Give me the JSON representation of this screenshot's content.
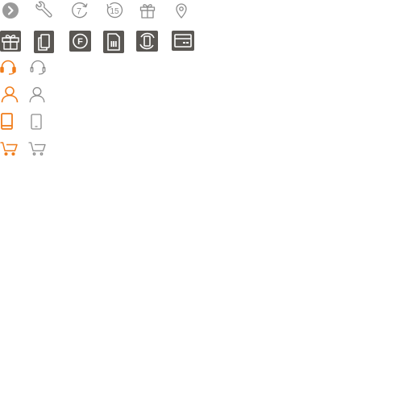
{
  "colors": {
    "gray": "#8c8c8c",
    "dark_tile": "#5a5753",
    "tile_glyph": "#ffffff",
    "orange": "#f07d1b",
    "chevron_bg": "#9a9a9a"
  },
  "row1": {
    "icons": [
      "chevron-right-icon",
      "wrench-icon",
      "seven-day-return-icon",
      "fifteen-day-return-icon",
      "gift-icon",
      "location-pin-icon"
    ],
    "seven_label": "7",
    "fifteen_label": "15"
  },
  "row2": {
    "icons": [
      "gift-tile-icon",
      "phone-tile-icon",
      "f-coin-tile-icon",
      "sim-card-tile-icon",
      "phone-rotate-tile-icon",
      "bank-card-tile-icon"
    ],
    "f_label": "F"
  },
  "states": {
    "rows": [
      {
        "name": "headset",
        "icons": [
          "headset-active-icon",
          "headset-icon"
        ]
      },
      {
        "name": "user",
        "icons": [
          "user-active-icon",
          "user-icon"
        ]
      },
      {
        "name": "tablet",
        "icons": [
          "tablet-active-icon",
          "tablet-icon"
        ]
      },
      {
        "name": "cart",
        "icons": [
          "cart-active-icon",
          "cart-icon"
        ]
      }
    ]
  }
}
